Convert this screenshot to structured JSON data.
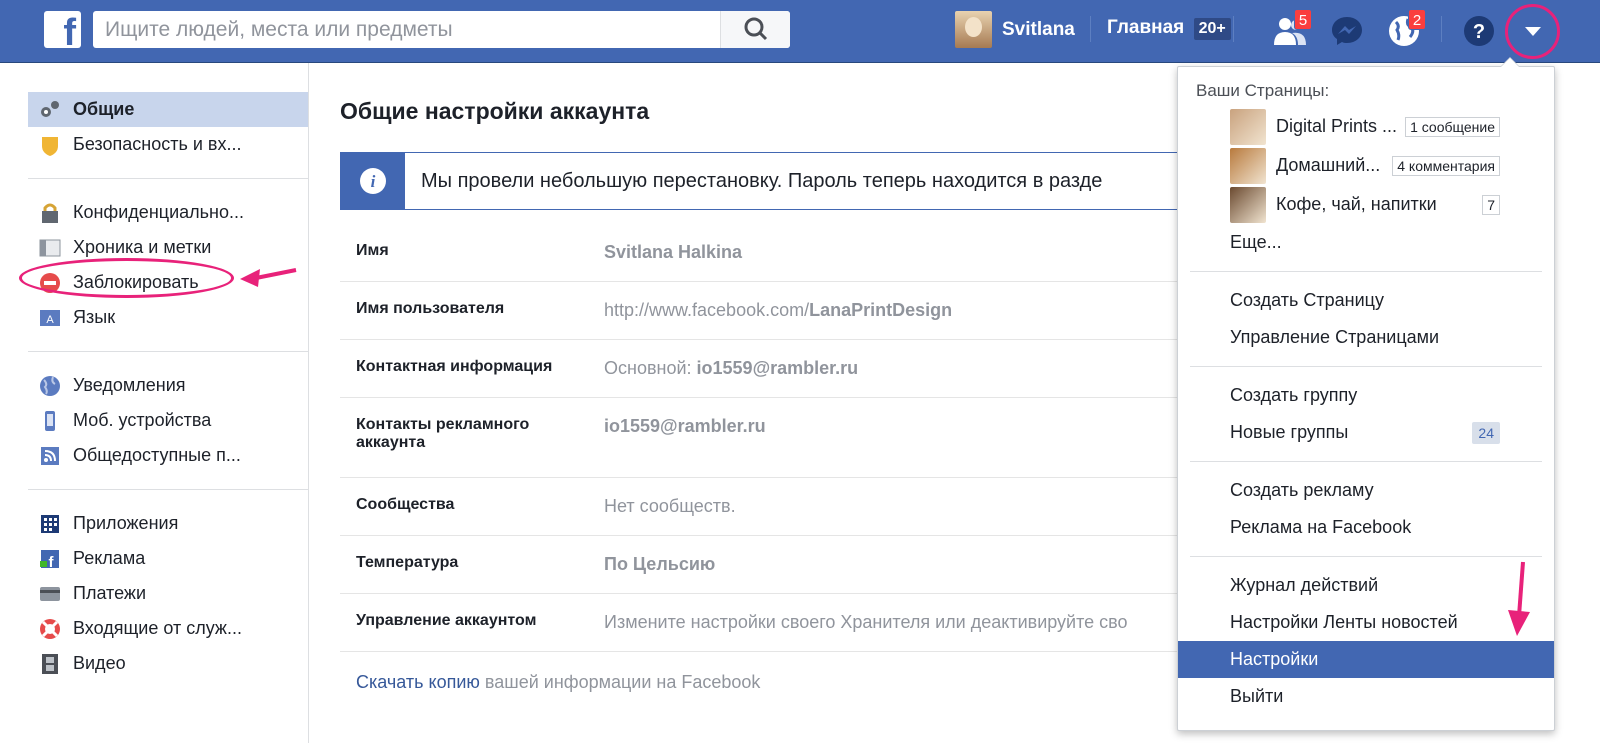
{
  "topbar": {
    "logo": "f",
    "search_placeholder": "Ищите людей, места или предметы",
    "profile_name": "Svitlana",
    "home_label": "Главная",
    "home_count": "20+",
    "friend_requests_badge": "5",
    "notifications_badge": "2"
  },
  "sidebar": {
    "groups": [
      [
        {
          "label": "Общие",
          "icon": "gear-icon",
          "active": true
        },
        {
          "label": "Безопасность и вх...",
          "icon": "shield-icon"
        }
      ],
      [
        {
          "label": "Конфиденциально...",
          "icon": "lock-icon"
        },
        {
          "label": "Хроника и метки",
          "icon": "timeline-icon"
        },
        {
          "label": "Заблокировать",
          "icon": "block-icon"
        },
        {
          "label": "Язык",
          "icon": "language-icon"
        }
      ],
      [
        {
          "label": "Уведомления",
          "icon": "globe-icon"
        },
        {
          "label": "Моб. устройства",
          "icon": "phone-icon"
        },
        {
          "label": "Общедоступные п...",
          "icon": "rss-icon"
        }
      ],
      [
        {
          "label": "Приложения",
          "icon": "apps-icon"
        },
        {
          "label": "Реклама",
          "icon": "ads-icon"
        },
        {
          "label": "Платежи",
          "icon": "card-icon"
        },
        {
          "label": "Входящие от служ...",
          "icon": "lifebuoy-icon"
        },
        {
          "label": "Видео",
          "icon": "film-icon"
        }
      ]
    ]
  },
  "main": {
    "title": "Общие настройки аккаунта",
    "info_text": "Мы провели небольшую перестановку. Пароль теперь находится в разде",
    "rows": [
      {
        "label": "Имя",
        "value": "Svitlana Halkina",
        "bold": true
      },
      {
        "label": "Имя пользователя",
        "prefix": "http://www.facebook.com/",
        "value": "LanaPrintDesign"
      },
      {
        "label": "Контактная информация",
        "prefix": "Основной: ",
        "value": "io1559@rambler.ru"
      },
      {
        "label": "Контакты рекламного аккаунта",
        "value": "io1559@rambler.ru",
        "bold": true
      },
      {
        "label": "Сообщества",
        "value": "Нет сообществ."
      },
      {
        "label": "Температура",
        "value": "По Цельсию",
        "bold": true
      },
      {
        "label": "Управление аккаунтом",
        "value": "Измените настройки своего Хранителя или деактивируйте сво"
      }
    ],
    "download_link": "Скачать копию",
    "download_rest": " вашей информации на Facebook"
  },
  "menu": {
    "pages_header": "Ваши Страницы:",
    "pages": [
      {
        "name": "Digital Prints ...",
        "count": "1 сообщение",
        "color": "#c9a27e"
      },
      {
        "name": "Домашний...",
        "count": "4 комментария",
        "color": "#b87a3d"
      },
      {
        "name": "Кофе, чай, напитки",
        "count": "7",
        "color": "#6b4a30"
      }
    ],
    "more": "Еще...",
    "section2": [
      "Создать Страницу",
      "Управление Страницами"
    ],
    "section3": [
      {
        "label": "Создать группу"
      },
      {
        "label": "Новые группы",
        "count": "24"
      }
    ],
    "section4": [
      "Создать рекламу",
      "Реклама на Facebook"
    ],
    "section5": [
      "Журнал действий",
      "Настройки Ленты новостей",
      "Настройки",
      "Выйти"
    ]
  },
  "colors": {
    "brand": "#4267b2",
    "annotation": "#e8227a"
  }
}
